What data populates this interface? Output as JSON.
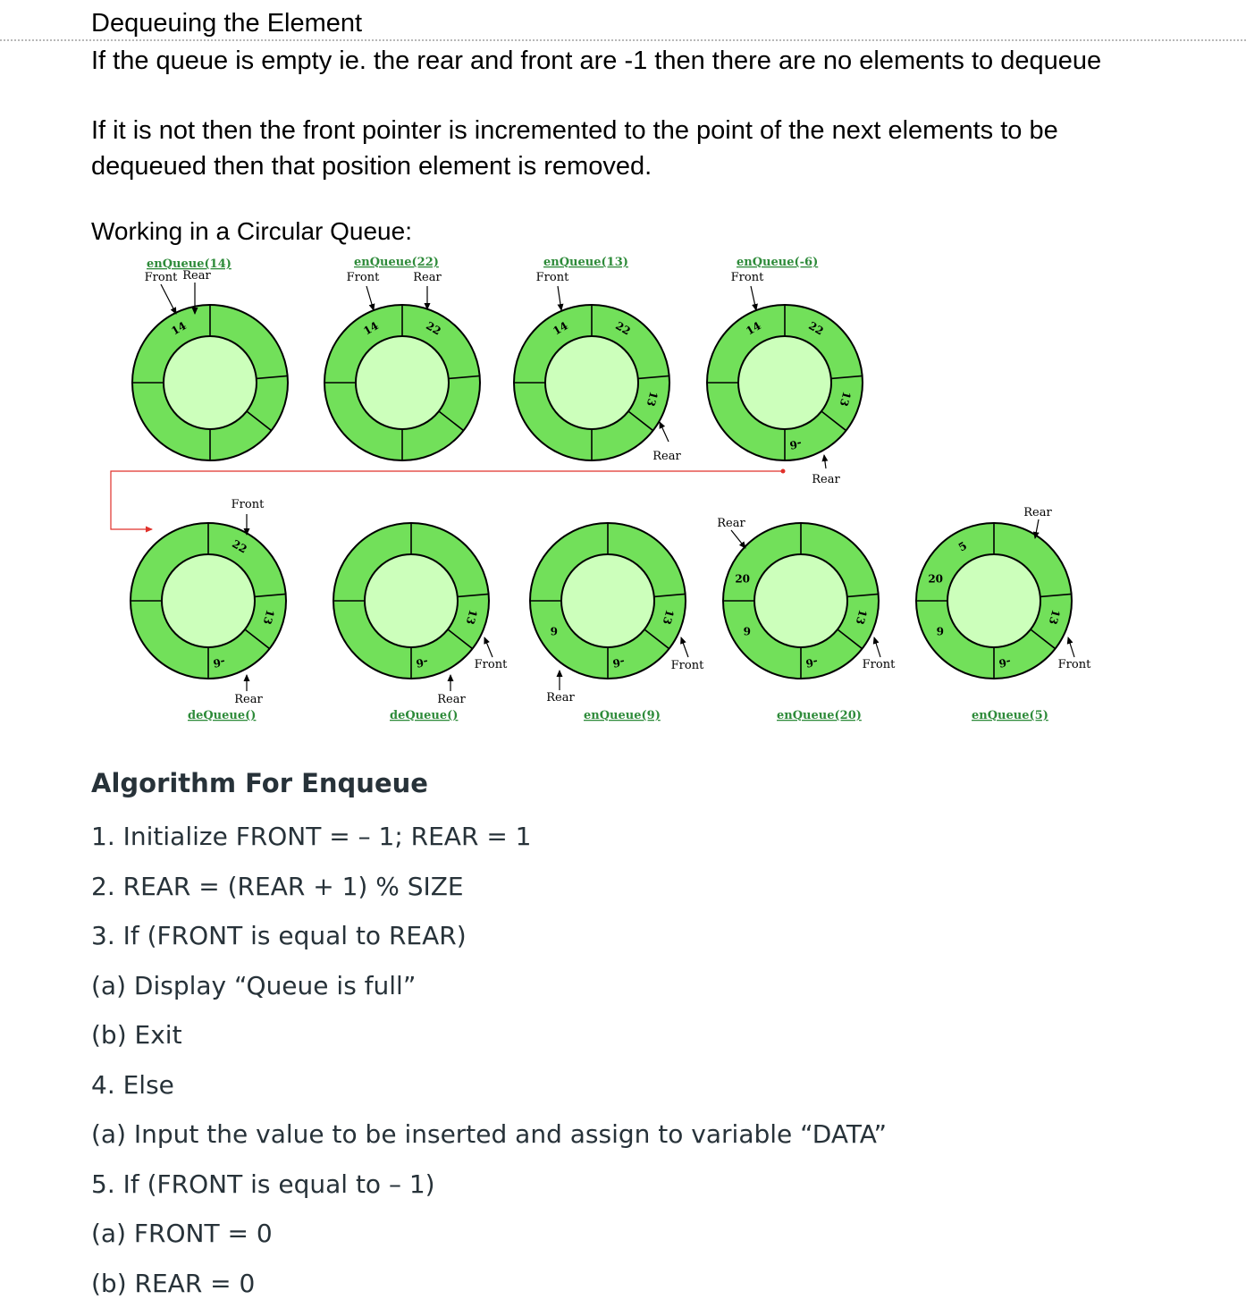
{
  "section_heading": "Dequeuing the Element",
  "paragraphs": [
    "If the queue is empty ie. the rear and front are -1 then there are no elements to dequeue",
    "If it is not then the front pointer is incremented to the point of the next elements to be dequeued then that position element is removed."
  ],
  "diagram_heading": "Working in a Circular Queue:",
  "diagram": {
    "colors": {
      "ring": "#72e05a",
      "inner": "#ccffbb",
      "stroke": "#000000",
      "operation_text": "#2e8b3a",
      "flow_arrow": "#e0302a"
    },
    "pointer_labels": {
      "front": "Front",
      "rear": "Rear"
    },
    "steps": [
      {
        "operation": "enQueue(14)",
        "slots": [
          "14",
          "",
          "",
          "",
          "",
          ""
        ]
      },
      {
        "operation": "enQueue(22)",
        "slots": [
          "14",
          "22",
          "",
          "",
          "",
          ""
        ]
      },
      {
        "operation": "enQueue(13)",
        "slots": [
          "14",
          "22",
          "13",
          "",
          "",
          ""
        ]
      },
      {
        "operation": "enQueue(-6)",
        "slots": [
          "14",
          "22",
          "13",
          "-6",
          "",
          ""
        ]
      },
      {
        "operation": "deQueue()",
        "slots": [
          "",
          "22",
          "13",
          "-6",
          "",
          ""
        ]
      },
      {
        "operation": "deQueue()",
        "slots": [
          "",
          "",
          "13",
          "-6",
          "",
          ""
        ]
      },
      {
        "operation": "enQueue(9)",
        "slots": [
          "",
          "",
          "13",
          "-6",
          "9",
          ""
        ]
      },
      {
        "operation": "enQueue(20)",
        "slots": [
          "",
          "",
          "13",
          "-6",
          "9",
          "20"
        ]
      },
      {
        "operation": "enQueue(5)",
        "slots": [
          "5",
          "",
          "13",
          "-6",
          "9",
          "20"
        ]
      }
    ]
  },
  "algorithm_title": "Algorithm For Enqueue",
  "algorithm_steps": [
    "1. Initialize FRONT = – 1; REAR = 1",
    "2. REAR = (REAR + 1) % SIZE",
    "3. If (FRONT is equal to REAR)",
    "(a) Display “Queue is full”",
    "(b) Exit",
    "4. Else",
    "(a) Input the value to be inserted and assign to variable “DATA”",
    "5. If (FRONT is equal to – 1)",
    "(a) FRONT = 0",
    "(b) REAR = 0"
  ]
}
